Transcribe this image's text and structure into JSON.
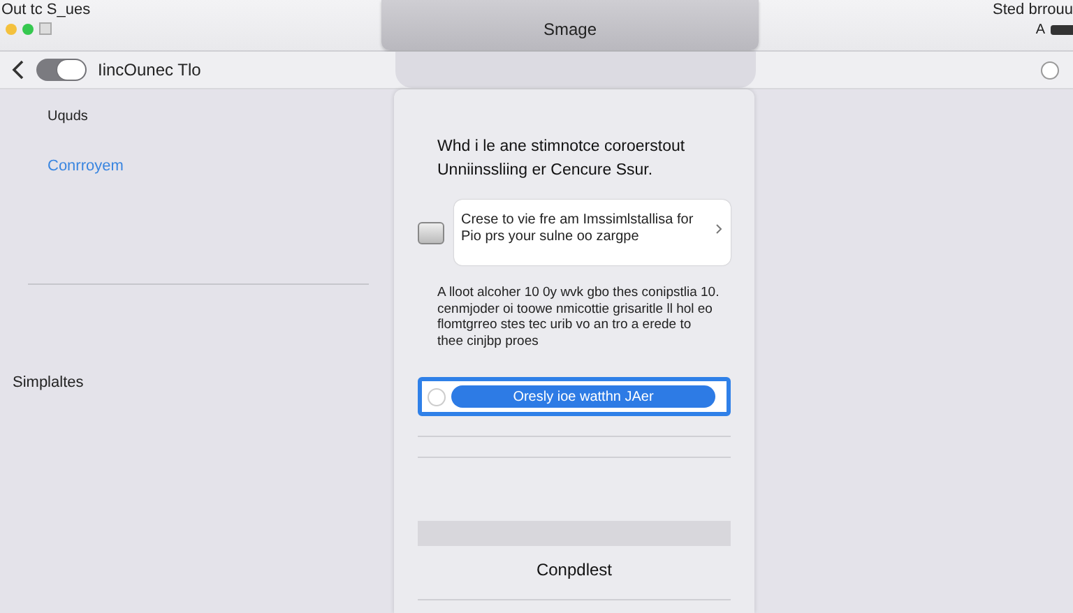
{
  "menu_bar": {
    "title": "Out tc S_ues",
    "right_text": "Sted brrouu",
    "right_letter": "A"
  },
  "window_controls": [
    {
      "kind": "dot",
      "color": "#f4c13d"
    },
    {
      "kind": "dot",
      "color": "#35c84f"
    },
    {
      "kind": "square"
    }
  ],
  "header": {
    "title": "Smage"
  },
  "toolbar": {
    "toggle": {
      "on": true
    },
    "label": "IincOunec Tlo",
    "radio": {
      "selected": false
    }
  },
  "sidebar": {
    "sections": [
      {
        "items": [
          {
            "label": "Uquds",
            "selected": false
          },
          {
            "label": "Conrroyem",
            "selected": true
          }
        ]
      },
      {
        "items": [
          {
            "label": "Simplaltes",
            "selected": false
          }
        ]
      }
    ]
  },
  "dialog": {
    "heading": "Whd i le ane stimnotce coroerstout Unniinssliing er Cencure Ssur.",
    "option": {
      "checked": false,
      "text": "Crese to vie fre am Imssimlstallisa for Pio prs your sulne oo zargpe"
    },
    "description": "A lloot alcoher 10 0y wvk gbo thes conipstlia 10. cenmjoder oi toowe nmicottie grisaritle ll hol eo flomtgrreo stes tec urib vo an tro a erede to thee cinjbp proes",
    "choice": {
      "selected": true,
      "button": "Oresly ioe watthn JAer"
    },
    "footer_button": "Conpdlest"
  }
}
